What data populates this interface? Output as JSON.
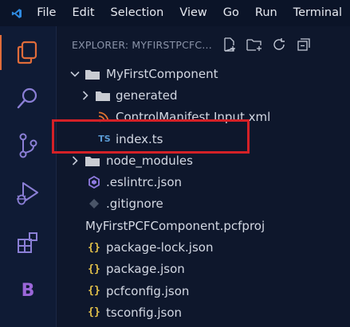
{
  "menubar": {
    "items": [
      "File",
      "Edit",
      "Selection",
      "View",
      "Go",
      "Run",
      "Terminal"
    ]
  },
  "activitybar": {
    "icons": [
      "explorer-icon",
      "search-icon",
      "source-control-icon",
      "run-debug-icon",
      "extensions-icon",
      "b-extension-icon"
    ],
    "b_label": "B"
  },
  "explorer": {
    "title": "EXPLORER: MYFIRSTPCFC...",
    "tree": [
      {
        "label": "MyFirstComponent",
        "type": "folder",
        "expanded": true
      },
      {
        "label": "generated",
        "type": "folder",
        "expanded": false
      },
      {
        "label": "ControlManifest.Input.xml",
        "type": "xml"
      },
      {
        "label": "index.ts",
        "type": "ts",
        "icon_text": "TS"
      },
      {
        "label": "node_modules",
        "type": "folder",
        "expanded": false
      },
      {
        "label": ".eslintrc.json",
        "type": "eslint"
      },
      {
        "label": ".gitignore",
        "type": "git"
      },
      {
        "label": "MyFirstPCFComponent.pcfproj",
        "type": "file"
      },
      {
        "label": "package-lock.json",
        "type": "json",
        "icon_text": "{}"
      },
      {
        "label": "package.json",
        "type": "json",
        "icon_text": "{}"
      },
      {
        "label": "pcfconfig.json",
        "type": "json",
        "icon_text": "{}"
      },
      {
        "label": "tsconfig.json",
        "type": "json",
        "icon_text": "{}"
      }
    ]
  },
  "colors": {
    "accent": "#e06c3a",
    "highlight": "#d42127",
    "json_icon": "#e5c34a",
    "ts_icon": "#5a9bd5",
    "eslint_icon": "#8f7be0"
  }
}
